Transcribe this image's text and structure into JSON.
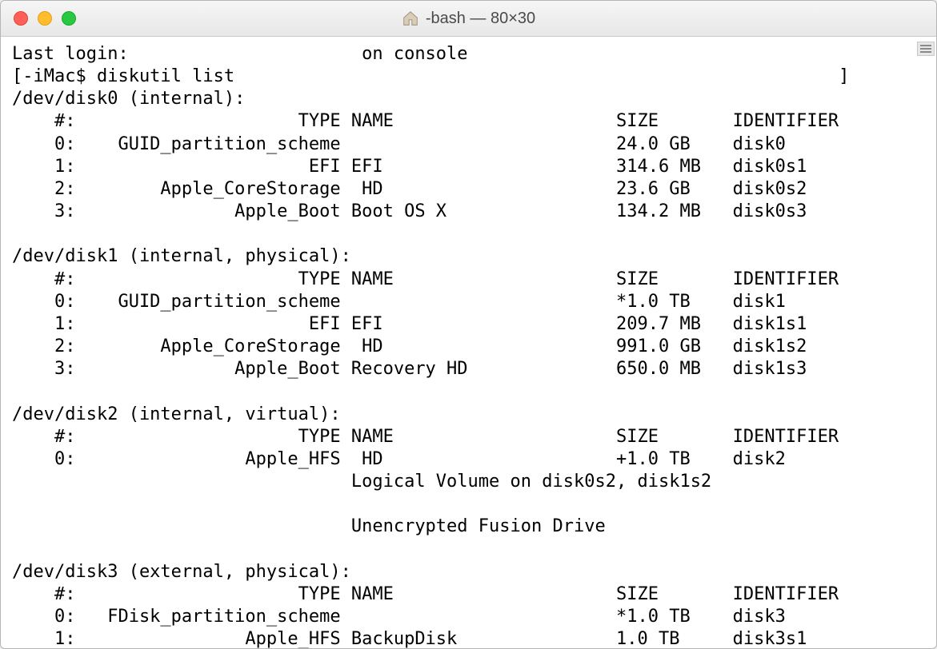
{
  "window": {
    "title": "-bash — 80×30"
  },
  "login_line": "Last login:                      on console",
  "prompt_line": "[-iMac$ diskutil list                                                         ]",
  "disks": [
    {
      "device": "/dev/disk0",
      "attrs": "(internal):",
      "rows": [
        {
          "num": "#:",
          "type": "TYPE",
          "name": "NAME",
          "size": "SIZE",
          "id": "IDENTIFIER"
        },
        {
          "num": "0:",
          "type": "GUID_partition_scheme",
          "name": "",
          "size": "24.0 GB",
          "id": "disk0"
        },
        {
          "num": "1:",
          "type": "EFI",
          "name": "EFI",
          "size": "314.6 MB",
          "id": "disk0s1"
        },
        {
          "num": "2:",
          "type": "Apple_CoreStorage",
          "name": " HD",
          "size": "23.6 GB",
          "id": "disk0s2"
        },
        {
          "num": "3:",
          "type": "Apple_Boot",
          "name": "Boot OS X",
          "size": "134.2 MB",
          "id": "disk0s3"
        }
      ]
    },
    {
      "device": "/dev/disk1",
      "attrs": "(internal, physical):",
      "rows": [
        {
          "num": "#:",
          "type": "TYPE",
          "name": "NAME",
          "size": "SIZE",
          "id": "IDENTIFIER"
        },
        {
          "num": "0:",
          "type": "GUID_partition_scheme",
          "name": "",
          "size": "*1.0 TB",
          "id": "disk1"
        },
        {
          "num": "1:",
          "type": "EFI",
          "name": "EFI",
          "size": "209.7 MB",
          "id": "disk1s1"
        },
        {
          "num": "2:",
          "type": "Apple_CoreStorage",
          "name": " HD",
          "size": "991.0 GB",
          "id": "disk1s2"
        },
        {
          "num": "3:",
          "type": "Apple_Boot",
          "name": "Recovery HD",
          "size": "650.0 MB",
          "id": "disk1s3"
        }
      ]
    },
    {
      "device": "/dev/disk2",
      "attrs": "(internal, virtual):",
      "rows": [
        {
          "num": "#:",
          "type": "TYPE",
          "name": "NAME",
          "size": "SIZE",
          "id": "IDENTIFIER"
        },
        {
          "num": "0:",
          "type": "Apple_HFS",
          "name": " HD",
          "size": "+1.0 TB",
          "id": "disk2"
        }
      ],
      "extra": [
        "Logical Volume on disk0s2, disk1s2",
        "",
        "Unencrypted Fusion Drive"
      ]
    },
    {
      "device": "/dev/disk3",
      "attrs": "(external, physical):",
      "rows": [
        {
          "num": "#:",
          "type": "TYPE",
          "name": "NAME",
          "size": "SIZE",
          "id": "IDENTIFIER"
        },
        {
          "num": "0:",
          "type": "FDisk_partition_scheme",
          "name": "",
          "size": "*1.0 TB",
          "id": "disk3"
        },
        {
          "num": "1:",
          "type": "Apple_HFS",
          "name": "BackupDisk",
          "size": "1.0 TB",
          "id": "disk3s1"
        }
      ]
    }
  ],
  "columns": {
    "num_stop": 6,
    "type_stop": 31,
    "name_start": 32,
    "size_start": 57,
    "id_start": 68
  }
}
